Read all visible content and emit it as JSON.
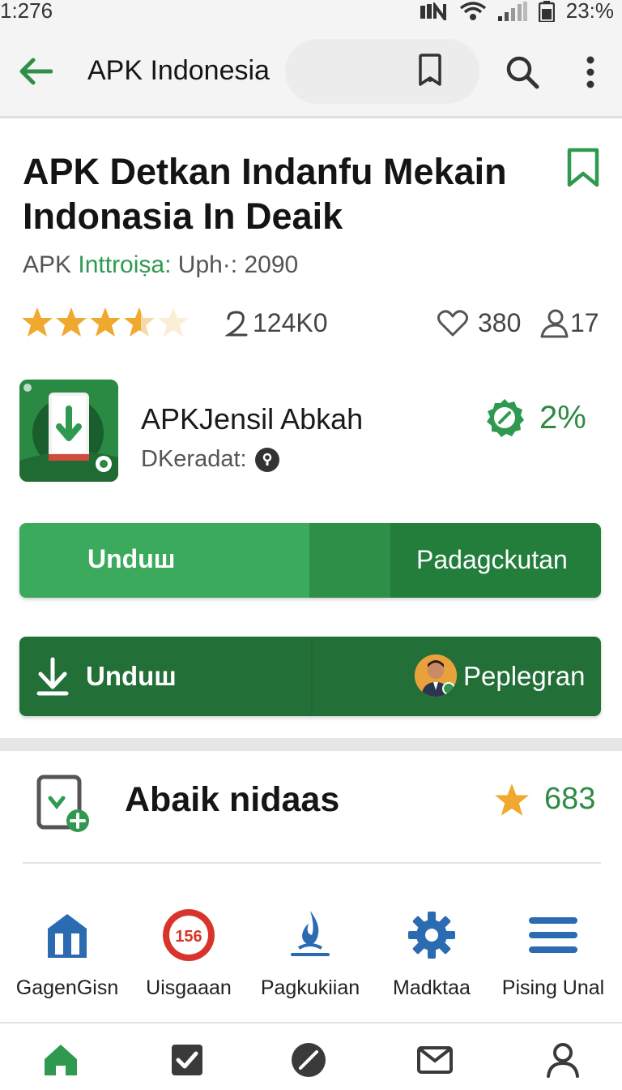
{
  "status_bar": {
    "time": "1:276",
    "battery": "23:%"
  },
  "app_bar": {
    "title": "APK Indonesia"
  },
  "content": {
    "title": "APK Detkan Indanfu Mekain Indonasia In Deaik",
    "subtitle_prefix": "APK ",
    "subtitle_highlight": "Inttroiṣa:",
    "subtitle_suffix": " Uph·: 2090",
    "rating_stars": 3.5,
    "downloads": "124K0",
    "likes": "380",
    "users": "17"
  },
  "app_info": {
    "name": "APKJensil Abkah",
    "sub_label": "DKeradat:",
    "percent": "2%"
  },
  "buttons": {
    "split_left": "Unduш",
    "split_right": "Padagckutan",
    "download_label": "Unduш",
    "download_right": "Peplegran"
  },
  "section": {
    "title": "Abaik nidaas",
    "score": "683"
  },
  "categories": [
    {
      "label": "GagenGisn",
      "icon": "building-icon"
    },
    {
      "label": "Uisgaaan",
      "icon": "badge-156-icon",
      "badge": "156"
    },
    {
      "label": "Pagkukiian",
      "icon": "flame-icon"
    },
    {
      "label": "Madktaa",
      "icon": "gear-icon"
    },
    {
      "label": "Pising Unal",
      "icon": "menu-lines-icon"
    }
  ],
  "bottom_nav": [
    {
      "icon": "home-icon"
    },
    {
      "icon": "checkbox-icon"
    },
    {
      "icon": "blocked-icon"
    },
    {
      "icon": "mail-icon"
    },
    {
      "icon": "profile-icon"
    }
  ],
  "colors": {
    "primary_green": "#2f9a4f",
    "dark_green": "#236f38",
    "star": "#f0a92e",
    "blue_icon": "#2b6bb2",
    "badge_red": "#d9342b"
  }
}
